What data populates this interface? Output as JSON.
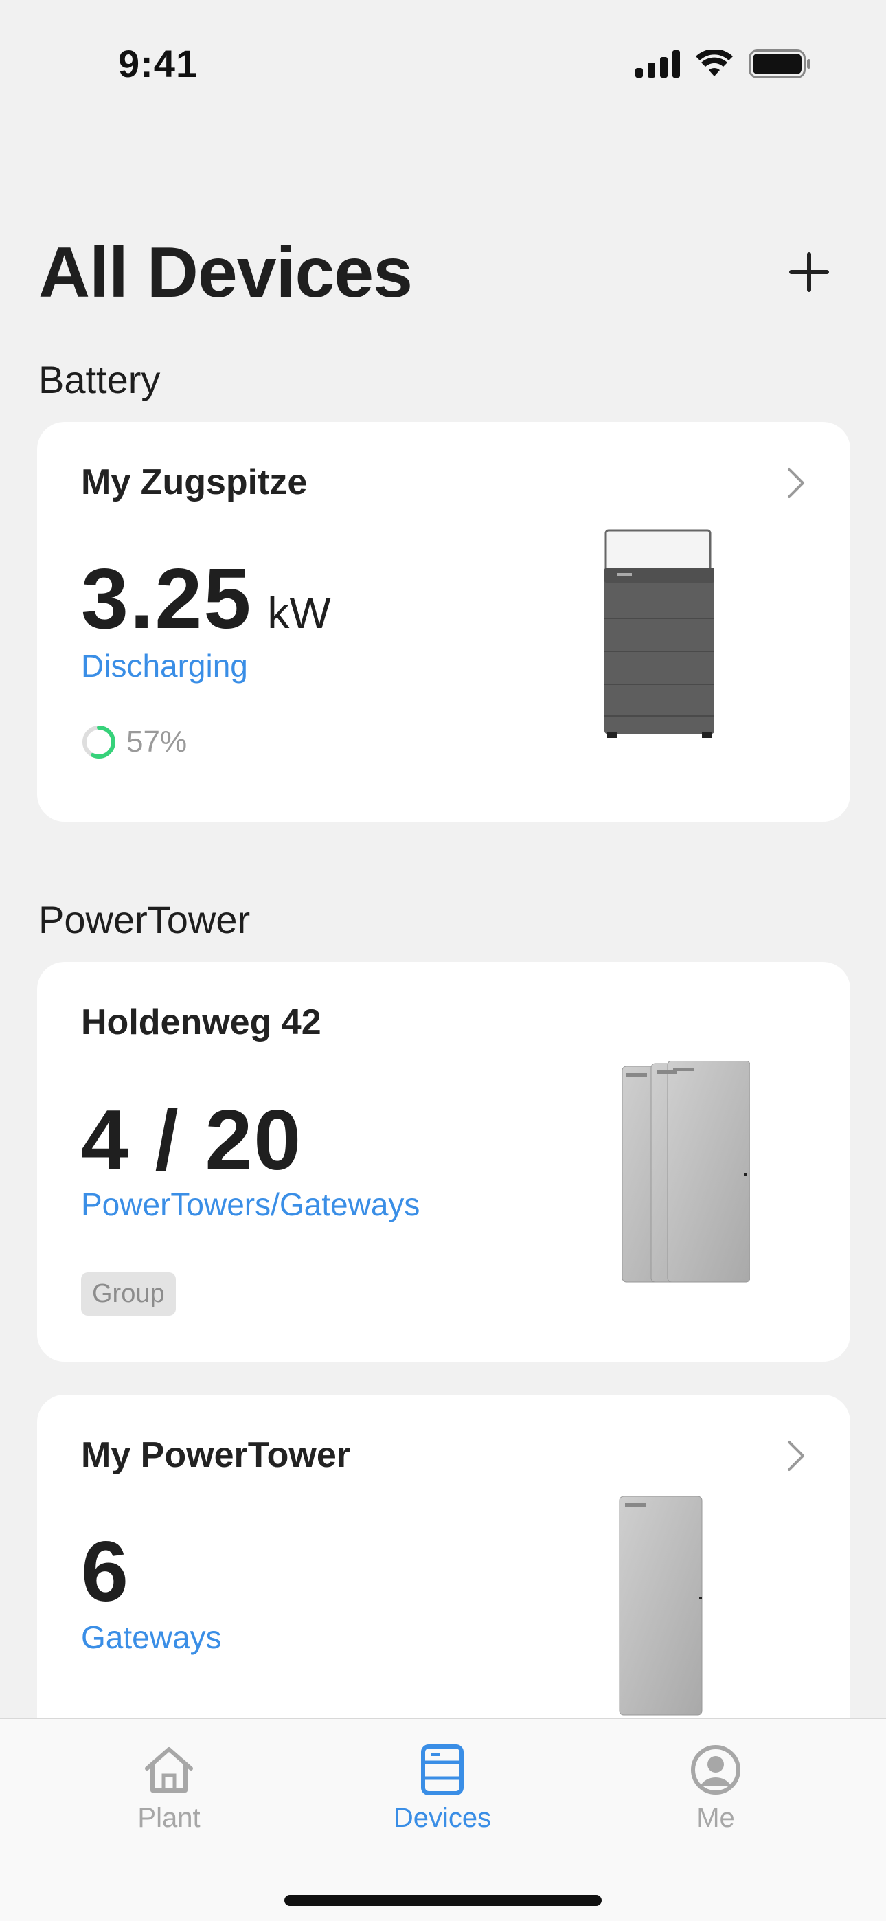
{
  "status_bar": {
    "time": "9:41"
  },
  "header": {
    "title": "All Devices"
  },
  "sections": {
    "battery": {
      "label": "Battery"
    },
    "powertower": {
      "label": "PowerTower"
    }
  },
  "battery_card": {
    "name": "My Zugspitze",
    "value": "3.25",
    "unit": "kW",
    "status": "Discharging",
    "soc": "57%",
    "soc_fraction": 0.57,
    "soc_color": "#36d27a"
  },
  "group_card": {
    "name": "Holdenweg 42",
    "value": "4 / 20",
    "label": "PowerTowers/Gateways",
    "badge": "Group"
  },
  "powertower_card": {
    "name": "My PowerTower",
    "value": "6",
    "label": "Gateways"
  },
  "tabs": [
    {
      "label": "Plant",
      "icon": "home-icon",
      "active": false
    },
    {
      "label": "Devices",
      "icon": "devices-icon",
      "active": true
    },
    {
      "label": "Me",
      "icon": "profile-icon",
      "active": false
    }
  ],
  "colors": {
    "accent": "#3a8ee6",
    "background": "#f1f1f1"
  }
}
